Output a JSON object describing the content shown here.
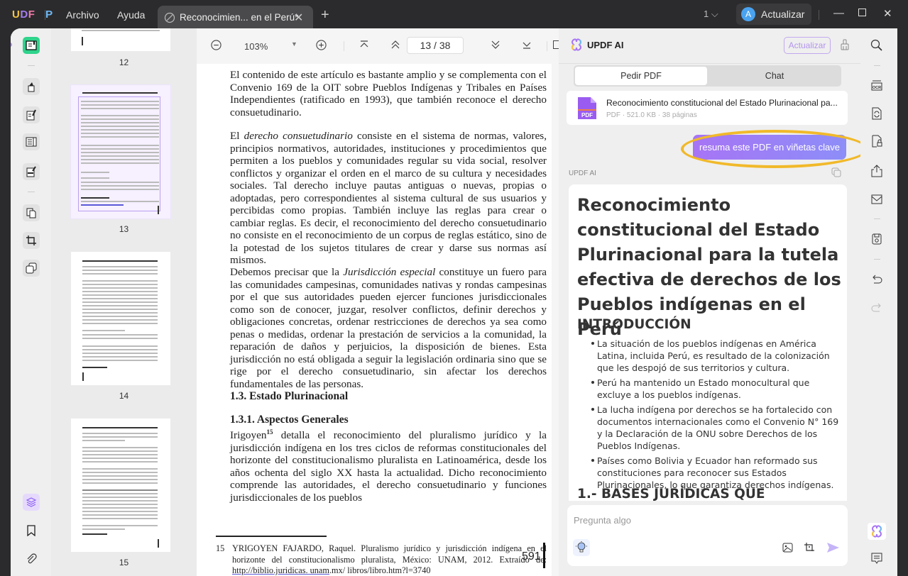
{
  "titlebar": {
    "logo": {
      "u": "U",
      "p": "P",
      "d": "D",
      "f": "F"
    },
    "menus": [
      "Archivo",
      "Ayuda"
    ],
    "tab_title": "Reconocimien... en el Perú*",
    "page_indicator": "1",
    "account_initial": "A",
    "account_button": "Actualizar"
  },
  "thumbnails": [
    {
      "page": "12"
    },
    {
      "page": "13",
      "selected": true
    },
    {
      "page": "14"
    },
    {
      "page": "15"
    }
  ],
  "toolbar": {
    "zoom": "103%",
    "page_input": "13 / 38"
  },
  "document": {
    "para1": "El contenido de este artículo es bastante amplio y se complementa con el Convenio 169 de la OIT sobre Pueblos Indígenas y Tribales en Países Independientes (ratificado en 1993), que también reconoce el derecho consuetudinario.",
    "para2_pre": "El ",
    "para2_em": "derecho consuetudinario",
    "para2_post": " consiste en el sistema de normas, valores, principios normativos, autoridades, instituciones y procedimientos que permiten a los pueblos y comunidades regular su vida social, resolver conflictos y organizar el orden en el marco de su cultura y necesidades sociales. Tal derecho incluye pautas antiguas o nuevas, propias o adoptadas, pero correspondientes al sistema cultural de sus usuarios y percibidas como propias. También incluye las reglas para crear o cambiar reglas. Es decir, el reconocimiento del derecho consuetudinario no consiste en el reconocimiento de un corpus de reglas estático, sino de la potestad de los sujetos titulares de crear y darse sus normas así mismos.",
    "para3_pre": "Debemos precisar que la ",
    "para3_em": "Jurisdicción especial",
    "para3_post": " constituye un fuero para las comunidades campesinas, comunidades nativas y rondas campesinas por el que sus autoridades pueden ejercer funciones jurisdiccionales como son de conocer, juzgar, resolver conflictos, definir derechos y obligaciones concretas, ordenar restricciones de derechos ya sea como penas o medidas, ordenar la prestación de servicios a la comunidad, la reparación de daños y perjuicios, la disposición de bienes. Esta jurisdicción no está obligada a seguir la legislación ordinaria sino que se rige por el derecho consuetudinario, sin afectar los derechos fundamentales de las personas.",
    "heading1": "1.3. Estado Plurinacional",
    "heading2": "1.3.1. Aspectos Generales",
    "para4_pre": "Irigoyen",
    "para4_sup": "15",
    "para4_post": " detalla el reconocimiento del pluralismo jurídico y la jurisdicción indígena en los tres ciclos de reformas constitucionales del horizonte del constitucionalismo pluralista en Latinoamérica, desde los años ochenta del siglo XX hasta la actualidad. Dicho reconocimiento comprende las autoridades, el derecho consuetudinario y funciones jurisdiccionales de los pueblos",
    "footnote_num": "15",
    "footnote_text": "YRIGOYEN FAJARDO, Raquel. Pluralismo jurídico y jurisdicción indígena en el horizonte del constitucionalismo pluralista, México: UNAM, 2012. Extraído de: ",
    "footnote_link": "http://biblio.juridicas. unam",
    "footnote_tail": ".mx/ libros/libro.htm?l=3740",
    "page_number": "591"
  },
  "ai_panel": {
    "title": "UPDF AI",
    "upgrade_button": "Actualizar",
    "tabs": [
      "Pedir PDF",
      "Chat"
    ],
    "file": {
      "name": "Reconocimiento constitucional del Estado Plurinacional pa...",
      "meta": "PDF · 521.0 KB · 38 páginas",
      "badge": "PDF"
    },
    "user_prompt": "resuma este PDF en viñetas clave",
    "response_label": "UPDF AI",
    "response": {
      "title": "Reconocimiento constitucional del Estado Plurinacional para la tutela efectiva de derechos de los Pueblos indígenas en el Perú",
      "section1": "INTRODUCCIÓN",
      "bullets": [
        "La situación de los pueblos indígenas en América Latina, incluida Perú, es resultado de la colonización que les despojó de sus territorios y cultura.",
        "Perú ha mantenido un Estado monocultural que excluye a los pueblos indígenas.",
        "La lucha indígena por derechos se ha fortalecido con documentos internacionales como el Convenio N° 169 y la Declaración de la ONU sobre Derechos de los Pueblos Indígenas.",
        "Países como Bolivia y Ecuador han reformado sus constituciones para reconocer sus Estados Plurinacionales, lo que garantiza derechos indígenas."
      ],
      "section2": "1.- BASES JURÍDICAS QUE"
    },
    "input_placeholder": "Pregunta algo"
  },
  "colors": {
    "accent": "#a774f5",
    "highlight_ring": "#f1b92a",
    "active_tool": "#2fd38b"
  }
}
